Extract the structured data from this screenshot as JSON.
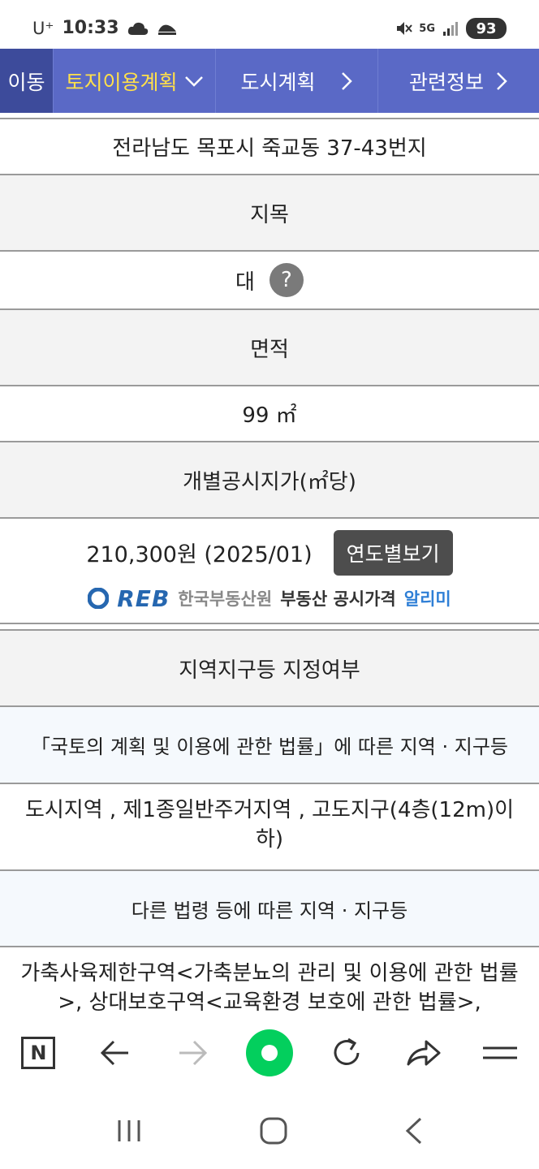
{
  "status_bar": {
    "carrier": "U⁺",
    "time": "10:33",
    "network": "5G",
    "battery": "93",
    "colors": {
      "text": "#333333"
    }
  },
  "nav": {
    "back_label": "이동",
    "active_tab_label": "토지이용계획",
    "city_label": "도시계획",
    "related_label": "관련정보",
    "colors": {
      "bar": "#5a69c6",
      "back": "#3d4b9b",
      "active_text": "#ffe04a"
    }
  },
  "content": {
    "address": "전라남도 목포시 죽교동 37-43번지",
    "land_category_header": "지목",
    "land_category_value": "대",
    "area_header": "면적",
    "area_value": "99 ㎡",
    "price_header": "개별공시지가(㎡당)",
    "price_value": "210,300원 (2025/01)",
    "year_button_label": "연도별보기",
    "reb": {
      "logo": "REB",
      "name": "한국부동산원",
      "slogan": "부동산 공시가격",
      "slogan_accent": "알리미"
    },
    "zoning_header": "지역지구등 지정여부",
    "law1_header": "「국토의 계획 및 이용에 관한 법률」에 따른 지역 · 지구등",
    "law1_value": "도시지역 , 제1종일반주거지역 , 고도지구(4층(12m)이하)",
    "law2_header": "다른 법령 등에 따른 지역 · 지구등",
    "law2_value": "가축사육제한구역<가축분뇨의 관리 및 이용에 관한 법률>, 상대보호구역<교육환경 보호에 관한 법률>,"
  },
  "toolbar": {
    "icons": [
      "naver-n-icon",
      "back-arrow-icon",
      "forward-arrow-icon",
      "green-dot-icon",
      "refresh-icon",
      "share-icon",
      "menu-icon"
    ],
    "colors": {
      "green": "#03cf5d",
      "icon": "#333333",
      "disabled": "#bbbbbb"
    }
  }
}
